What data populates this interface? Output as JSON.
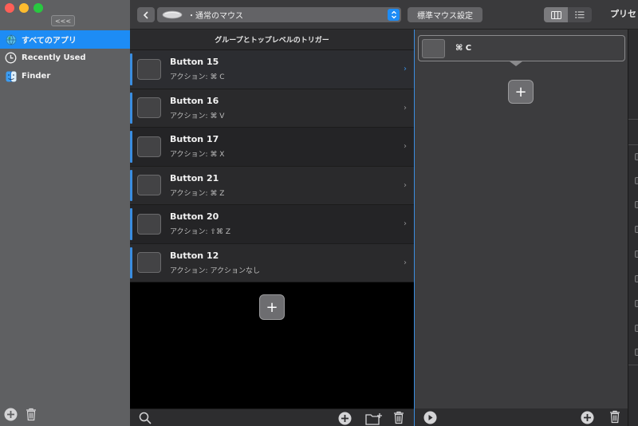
{
  "window": {
    "collapse_label": "<<<"
  },
  "sidebar": {
    "items": [
      {
        "label": "すべてのアプリ",
        "icon": "globe-icon",
        "selected": true
      },
      {
        "label": "Recently Used",
        "icon": "clock-icon",
        "selected": false
      },
      {
        "label": "Finder",
        "icon": "finder-icon",
        "selected": false
      }
    ]
  },
  "toolbar": {
    "device_name": "・通常のマウス",
    "std_button": "標準マウス設定",
    "preset_title": "プリセ"
  },
  "triggers": {
    "header": "グループとトップレベルのトリガー",
    "rows": [
      {
        "title": "Button 15",
        "action": "アクション: ⌘ C",
        "selected": true
      },
      {
        "title": "Button 16",
        "action": "アクション: ⌘ V",
        "selected": false
      },
      {
        "title": "Button 17",
        "action": "アクション: ⌘ X",
        "selected": false
      },
      {
        "title": "Button 21",
        "action": "アクション: ⌘ Z",
        "selected": false
      },
      {
        "title": "Button 20",
        "action": "アクション: ⇧⌘ Z",
        "selected": false
      },
      {
        "title": "Button 12",
        "action": "アクション: アクションなし",
        "selected": false
      }
    ],
    "add_label": "+"
  },
  "action_panel": {
    "action_label": "⌘ C",
    "add_label": "+"
  },
  "colors": {
    "accent": "#1d8cf5",
    "sidebar_bg": "#5f6062",
    "selection_bar": "#3a8de0"
  }
}
